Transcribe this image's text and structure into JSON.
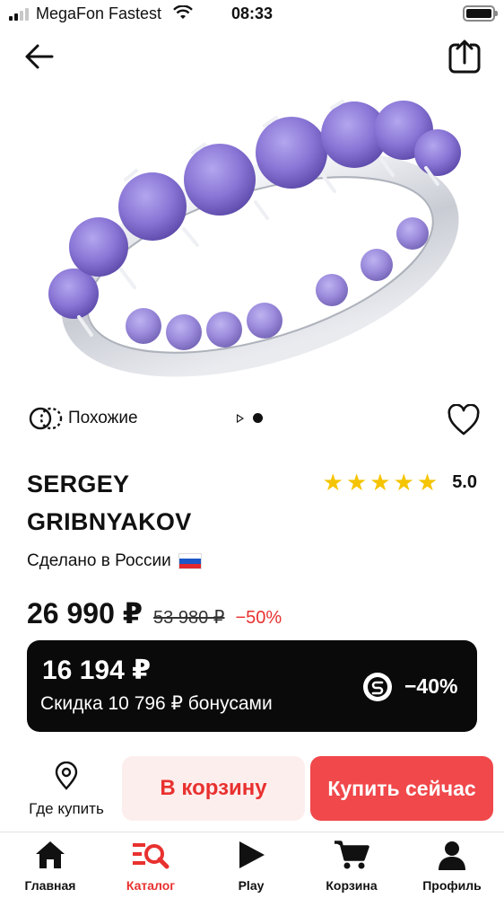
{
  "status_bar": {
    "carrier": "MegaFon Fastest",
    "time": "08:33"
  },
  "similar": {
    "label": "Похожие"
  },
  "product": {
    "brand_line1": "SERGEY",
    "brand_line2": "GRIBNYAKOV",
    "rating": "5.0",
    "made_in": "Сделано в России",
    "price": "26 990 ₽",
    "old_price": "53 980 ₽",
    "discount": "−50%"
  },
  "bonus": {
    "amount": "16 194 ₽",
    "description": "Скидка 10 796 ₽ бонусами",
    "percent": "−40%"
  },
  "actions": {
    "where_to_buy": "Где купить",
    "add_to_cart": "В корзину",
    "buy_now": "Купить сейчас"
  },
  "tabs": [
    {
      "label": "Главная",
      "icon": "home-icon"
    },
    {
      "label": "Каталог",
      "icon": "catalog-icon"
    },
    {
      "label": "Play",
      "icon": "play-icon"
    },
    {
      "label": "Корзина",
      "icon": "cart-icon"
    },
    {
      "label": "Профиль",
      "icon": "profile-icon"
    }
  ],
  "colors": {
    "accent": "#e8312f",
    "star": "#f5c400",
    "gem": "#8a76d6"
  }
}
